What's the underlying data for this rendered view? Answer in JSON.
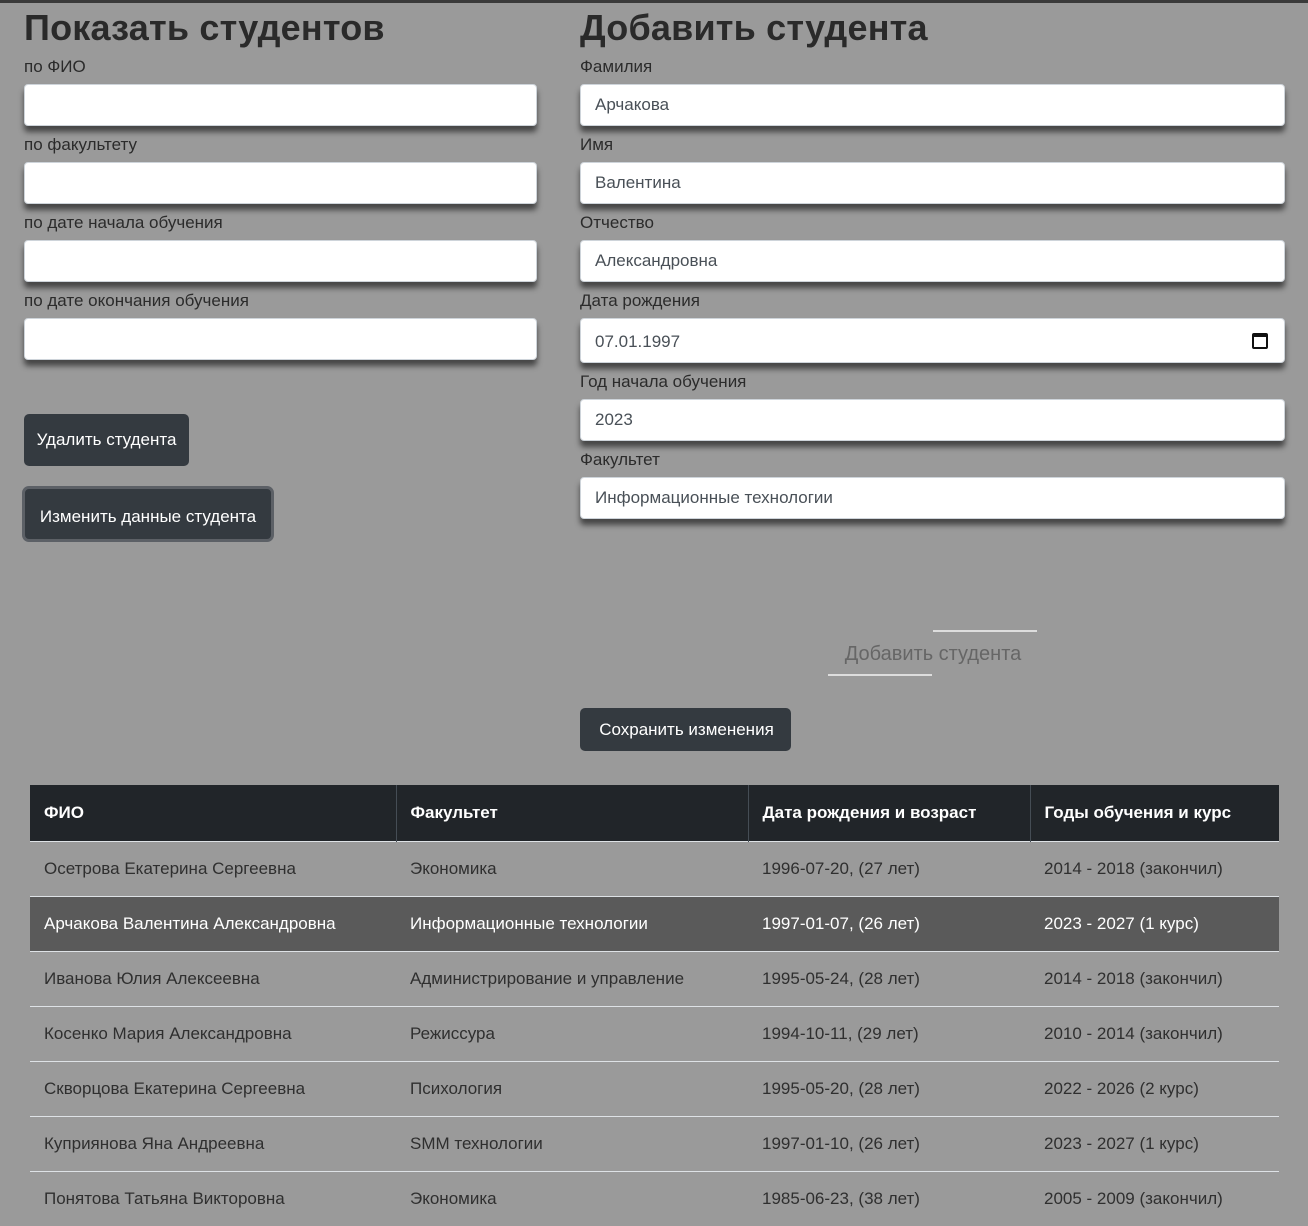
{
  "search": {
    "title": "Показать студентов",
    "fields": [
      {
        "label": "по ФИО",
        "value": ""
      },
      {
        "label": "по факультету",
        "value": ""
      },
      {
        "label": "по дате начала обучения",
        "value": ""
      },
      {
        "label": "по дате окончания обучения",
        "value": ""
      }
    ],
    "delete_label": "Удалить студента",
    "edit_label": "Изменить данные студента"
  },
  "add": {
    "title": "Добавить студента",
    "fields": [
      {
        "label": "Фамилия",
        "value": "Арчакова"
      },
      {
        "label": "Имя",
        "value": "Валентина"
      },
      {
        "label": "Отчество",
        "value": "Александровна"
      },
      {
        "label": "Дата рождения",
        "value": "07.01.1997"
      },
      {
        "label": "Год начала обучения",
        "value": "2023"
      },
      {
        "label": "Факультет",
        "value": "Информационные технологии"
      }
    ],
    "add_label": "Добавить студента",
    "save_label": "Сохранить изменения",
    "calendar_icon": "calendar-icon"
  },
  "table": {
    "headers": [
      "ФИО",
      "Факультет",
      "Дата рождения и возраст",
      "Годы обучения и курс"
    ],
    "rows": [
      [
        "Осетрова Екатерина Сергеевна",
        "Экономика",
        "1996-07-20, (27 лет)",
        "2014 - 2018 (закончил)"
      ],
      [
        "Арчакова Валентина Александровна",
        "Информационные технологии",
        "1997-01-07, (26 лет)",
        "2023 - 2027 (1 курс)"
      ],
      [
        "Иванова Юлия Алексеевна",
        "Администрирование и управление",
        "1995-05-24, (28 лет)",
        "2014 - 2018 (закончил)"
      ],
      [
        "Косенко Мария Александровна",
        "Режиссура",
        "1994-10-11, (29 лет)",
        "2010 - 2014 (закончил)"
      ],
      [
        "Скворцова Екатерина Сергеевна",
        "Психология",
        "1995-05-20, (28 лет)",
        "2022 - 2026 (2 курс)"
      ],
      [
        "Куприянова Яна Андреевна",
        "SMM технологии",
        "1997-01-10, (26 лет)",
        "2023 - 2027 (1 курс)"
      ],
      [
        "Понятова Татьяна Викторовна",
        "Экономика",
        "1985-06-23, (38 лет)",
        "2005 - 2009 (закончил)"
      ]
    ],
    "selected_row": 1
  },
  "colors": {
    "background": "#9a9a9a",
    "button_dark": "#343a40",
    "table_header": "#212529",
    "selected_row": "#5a5a5a"
  }
}
